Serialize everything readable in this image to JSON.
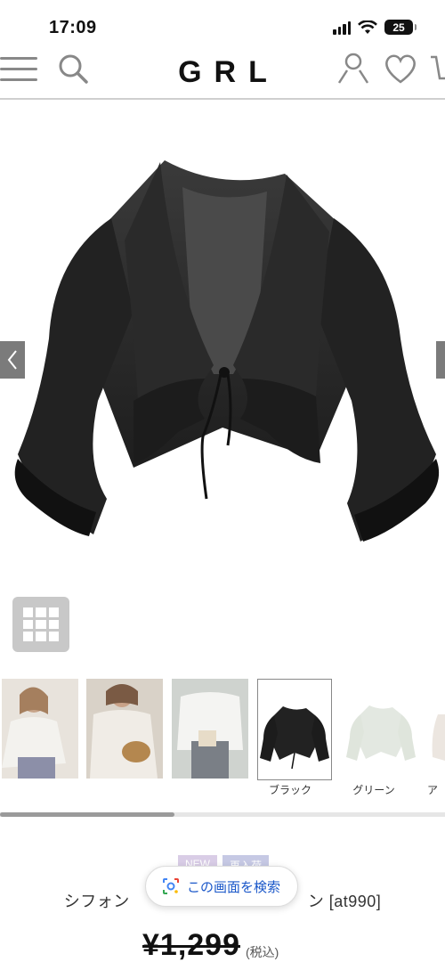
{
  "status_bar": {
    "time": "17:09",
    "battery": "25"
  },
  "header": {
    "logo": "GRL"
  },
  "product": {
    "badges": [
      "NEW",
      "再入荷"
    ],
    "title_left": "シフォン",
    "title_right": "ン [at990]",
    "price": "¥1,299",
    "tax_label": "(税込)"
  },
  "thumbnails": [
    {
      "label": ""
    },
    {
      "label": ""
    },
    {
      "label": ""
    },
    {
      "label": "ブラック"
    },
    {
      "label": "グリーン"
    },
    {
      "label": "ア"
    }
  ],
  "lens_popup": {
    "label": "この画面を検索"
  },
  "colors": {
    "accent": "#1a57c9",
    "scrollbar": "#9a9a9a"
  }
}
